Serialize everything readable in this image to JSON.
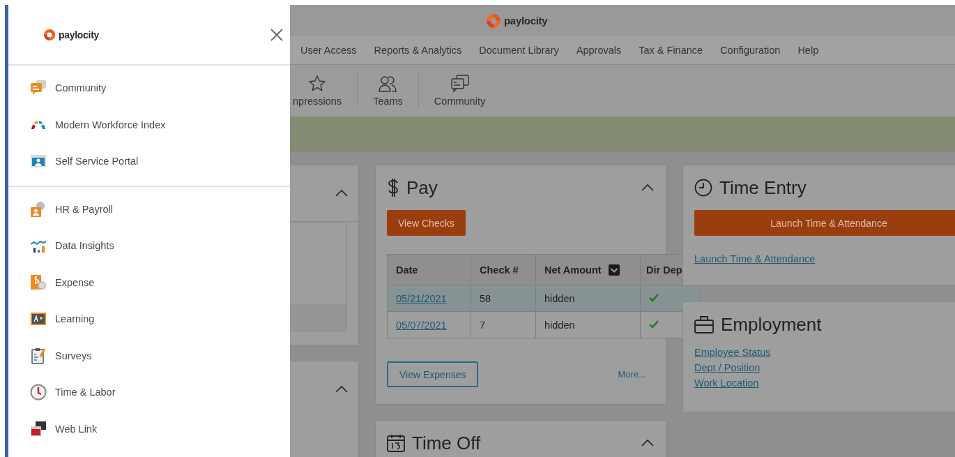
{
  "drawer": {
    "logo": "paylocity",
    "sections": [
      {
        "items": [
          {
            "label": "Community"
          },
          {
            "label": "Modern Workforce Index"
          },
          {
            "label": "Self Service Portal"
          }
        ]
      },
      {
        "items": [
          {
            "label": "HR & Payroll"
          },
          {
            "label": "Data Insights"
          },
          {
            "label": "Expense"
          },
          {
            "label": "Learning"
          },
          {
            "label": "Surveys"
          },
          {
            "label": "Time & Labor"
          },
          {
            "label": "Web Link"
          }
        ]
      }
    ]
  },
  "header": {
    "logo": "paylocity"
  },
  "nav": [
    "User Access",
    "Reports & Analytics",
    "Document Library",
    "Approvals",
    "Tax & Finance",
    "Configuration",
    "Help"
  ],
  "toolbar": [
    {
      "label": "npressions"
    },
    {
      "label": "Teams"
    },
    {
      "label": "Community"
    }
  ],
  "pay": {
    "title": "Pay",
    "primary_button": "View Checks",
    "columns": [
      "Date",
      "Check #",
      "Net Amount",
      "Dir Dep"
    ],
    "rows": [
      {
        "date": "05/21/2021",
        "check": "58",
        "net": "hidden",
        "dir_dep": true,
        "selected": true
      },
      {
        "date": "05/07/2021",
        "check": "7",
        "net": "hidden",
        "dir_dep": true,
        "selected": false
      }
    ],
    "secondary_button": "View Expenses",
    "more": "More..."
  },
  "time_off": {
    "title": "Time Off"
  },
  "time_entry": {
    "title": "Time Entry",
    "button": "Launch Time & Attendance",
    "link": "Launch Time & Attendance"
  },
  "employment": {
    "title": "Employment",
    "links": [
      "Employee Status",
      "Dept / Position",
      "Work Location"
    ]
  }
}
